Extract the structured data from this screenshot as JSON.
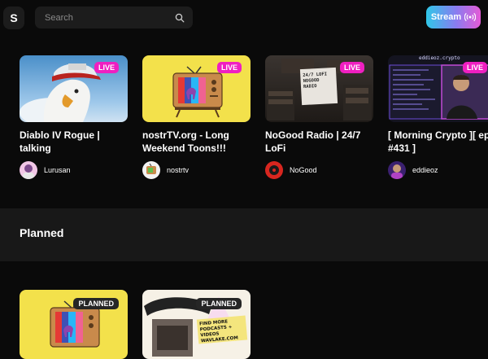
{
  "header": {
    "logo_letter": "S",
    "search_placeholder": "Search",
    "stream_label": "Stream"
  },
  "live_streams": [
    {
      "title": "Diablo IV Rogue | talking",
      "streamer": "Lurusan",
      "badge": "LIVE"
    },
    {
      "title": "nostrTV.org - Long Weekend Toons!!!",
      "streamer": "nostrtv",
      "badge": "LIVE"
    },
    {
      "title": "NoGood Radio | 24/7 LoFi",
      "streamer": "NoGood",
      "badge": "LIVE",
      "art_lines": [
        "24/7 LOFI",
        "NOGOOD",
        "RADIO"
      ]
    },
    {
      "title": "[ Morning Crypto ][ ep #431 ]",
      "streamer": "eddieoz",
      "badge": "LIVE",
      "art_header": "eddieoz.crypto"
    }
  ],
  "planned_section": {
    "title": "Planned",
    "items": [
      {
        "badge": "PLANNED"
      },
      {
        "badge": "PLANNED",
        "art_lines": [
          "FIND MORE",
          "PODCASTS + VIDEOS",
          "WAVLAKE.COM"
        ]
      }
    ]
  },
  "colors": {
    "live_badge": "#ef1fc1",
    "stream_gradient": [
      "#2fc7e8",
      "#8a7cf0",
      "#e45bd6"
    ]
  }
}
